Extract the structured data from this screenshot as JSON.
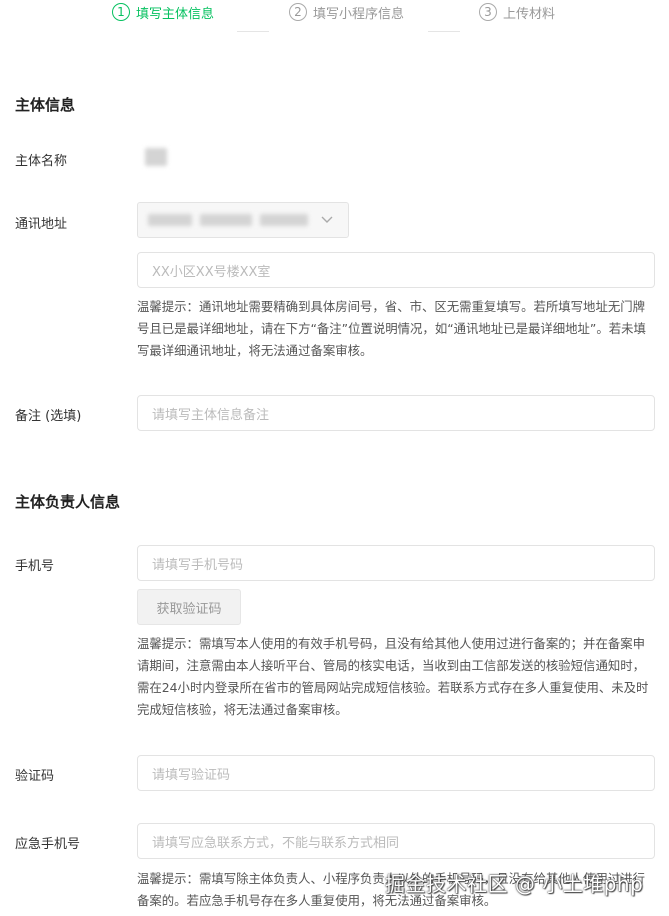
{
  "steps": [
    {
      "num": "1",
      "label": "填写主体信息",
      "active": true
    },
    {
      "num": "2",
      "label": "填写小程序信息",
      "active": false
    },
    {
      "num": "3",
      "label": "上传材料",
      "active": false
    }
  ],
  "section_subject": {
    "title": "主体信息",
    "name_label": "主体名称",
    "address_label": "通讯地址",
    "address_placeholder": "XX小区XX号楼XX室",
    "address_tip": "温馨提示：通讯地址需要精确到具体房间号，省、市、区无需重复填写。若所填写地址无门牌号且已是最详细地址，请在下方“备注”位置说明情况，如“通讯地址已是最详细地址”。若未填写最详细通讯地址，将无法通过备案审核。",
    "remark_label": "备注 (选填)",
    "remark_placeholder": "请填写主体信息备注"
  },
  "section_person": {
    "title": "主体负责人信息",
    "phone_label": "手机号",
    "phone_placeholder": "请填写手机号码",
    "get_code_button": "获取验证码",
    "phone_tip": "温馨提示：需填写本人使用的有效手机号码，且没有给其他人使用过进行备案的；并在备案申请期间，注意需由本人接听平台、管局的核实电话，当收到由工信部发送的核验短信通知时，需在24小时内登录所在省市的管局网站完成短信核验。若联系方式存在多人重复使用、未及时完成短信核验，将无法通过备案审核。",
    "code_label": "验证码",
    "code_placeholder": "请填写验证码",
    "emergency_label": "应急手机号",
    "emergency_placeholder": "请填写应急联系方式，不能与联系方式相同",
    "emergency_tip": "温馨提示：需填写除主体负责人、小程序负责人以外的手机号码，且没有给其他人使用过进行备案的。若应急手机号存在多人重复使用，将无法通过备案审核。"
  },
  "watermark": "掘金技术社区 @ 小土堆php",
  "colors": {
    "accent": "#07c160",
    "tip_text": "#555555",
    "border": "#e3e3e3"
  }
}
